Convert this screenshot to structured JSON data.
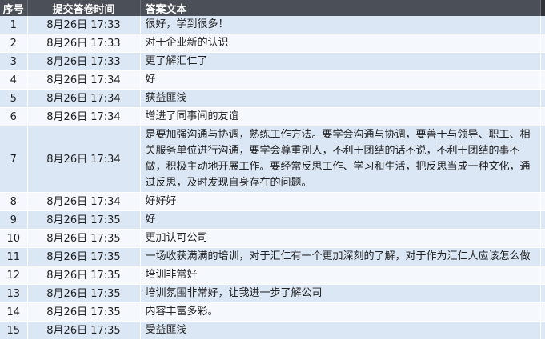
{
  "table": {
    "headers": [
      "序号",
      "提交答卷时间",
      "答案文本"
    ],
    "rows": [
      {
        "idx": "1",
        "time": "8月26日 17:33",
        "text": "很好，学到很多！"
      },
      {
        "idx": "2",
        "time": "8月26日 17:33",
        "text": "对于企业新的认识"
      },
      {
        "idx": "3",
        "time": "8月26日 17:33",
        "text": "更了解汇仁了"
      },
      {
        "idx": "4",
        "time": "8月26日 17:34",
        "text": "好"
      },
      {
        "idx": "5",
        "time": "8月26日 17:34",
        "text": "获益匪浅"
      },
      {
        "idx": "6",
        "time": "8月26日 17:34",
        "text": "增进了同事间的友谊"
      },
      {
        "idx": "7",
        "time": "8月26日 17:34",
        "text": "是要加强沟通与协调，熟练工作方法。要学会沟通与协调，要善于与领导、职工、相关服务单位进行沟通，要学会尊重别人，不利于团结的话不说，不利于团结的事不做，积极主动地开展工作。要经常反思工作、学习和生活，把反思当成一种文化，通过反思，及时发现自身存在的问题。"
      },
      {
        "idx": "8",
        "time": "8月26日 17:34",
        "text": "好好好"
      },
      {
        "idx": "9",
        "time": "8月26日 17:35",
        "text": "好"
      },
      {
        "idx": "10",
        "time": "8月26日 17:35",
        "text": "更加认可公司"
      },
      {
        "idx": "11",
        "time": "8月26日 17:35",
        "text": "一场收获满满的培训，对于汇仁有一个更加深刻的了解，对于作为汇仁人应该怎么做"
      },
      {
        "idx": "12",
        "time": "8月26日 17:35",
        "text": "培训非常好"
      },
      {
        "idx": "13",
        "time": "8月26日 17:35",
        "text": "培训氛围非常好，让我进一步了解公司"
      },
      {
        "idx": "14",
        "time": "8月26日 17:35",
        "text": "内容丰富多彩。"
      },
      {
        "idx": "15",
        "time": "8月26日 17:35",
        "text": "受益匪浅"
      }
    ]
  }
}
